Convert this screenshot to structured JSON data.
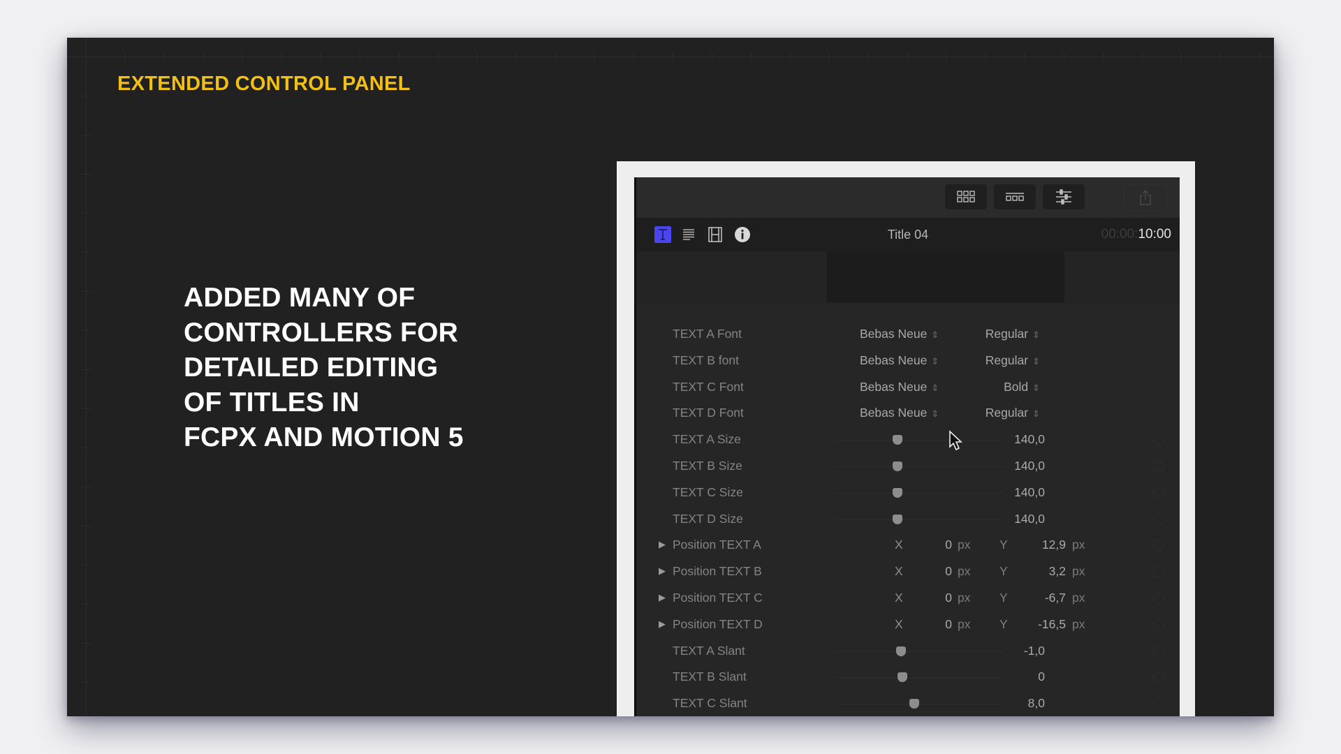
{
  "slide": {
    "heading": "EXTENDED CONTROL PANEL",
    "heading_color": "#f2c014",
    "body_lines": [
      "ADDED MANY OF",
      "CONTROLLERS FOR",
      "DETAILED EDITING",
      "OF TITLES IN",
      "FCPX AND MOTION 5"
    ]
  },
  "inspector": {
    "toolbar": {
      "buttons": [
        {
          "name": "browser-grid-icon"
        },
        {
          "name": "timeline-icon"
        },
        {
          "name": "inspector-sliders-icon"
        },
        {
          "name": "share-icon"
        }
      ]
    },
    "tabs": [
      {
        "name": "text-tab-icon",
        "active": true
      },
      {
        "name": "title-tab-icon",
        "active": false
      },
      {
        "name": "video-tab-icon",
        "active": false
      },
      {
        "name": "info-tab-icon",
        "active": false
      }
    ],
    "accent_color": "#4b45f0",
    "title": "Title 04",
    "timecode_dim": "00:00:",
    "timecode": "10:00",
    "fonts": [
      {
        "label": "TEXT A Font",
        "font": "Bebas Neue",
        "style": "Regular"
      },
      {
        "label": "TEXT B font",
        "font": "Bebas Neue",
        "style": "Regular"
      },
      {
        "label": "TEXT C Font",
        "font": "Bebas Neue",
        "style": "Bold"
      },
      {
        "label": "TEXT D Font",
        "font": "Bebas Neue",
        "style": "Regular"
      }
    ],
    "sizes": [
      {
        "label": "TEXT A Size",
        "value": "140,0",
        "slider_fraction": 0.37
      },
      {
        "label": "TEXT B Size",
        "value": "140,0",
        "slider_fraction": 0.37
      },
      {
        "label": "TEXT C Size",
        "value": "140,0",
        "slider_fraction": 0.37
      },
      {
        "label": "TEXT D Size",
        "value": "140,0",
        "slider_fraction": 0.37
      }
    ],
    "positions": [
      {
        "label": "Position TEXT A",
        "x_label": "X",
        "x": "0",
        "y_label": "Y",
        "y": "12,9",
        "unit": "px"
      },
      {
        "label": "Position TEXT B",
        "x_label": "X",
        "x": "0",
        "y_label": "Y",
        "y": "3,2",
        "unit": "px"
      },
      {
        "label": "Position TEXT C",
        "x_label": "X",
        "x": "0",
        "y_label": "Y",
        "y": "-6,7",
        "unit": "px"
      },
      {
        "label": "Position TEXT D",
        "x_label": "X",
        "x": "0",
        "y_label": "Y",
        "y": "-16,5",
        "unit": "px"
      }
    ],
    "slants": [
      {
        "label": "TEXT A Slant",
        "value": "-1,0",
        "slider_fraction": 0.39
      },
      {
        "label": "TEXT B Slant",
        "value": "0",
        "slider_fraction": 0.4
      },
      {
        "label": "TEXT C Slant",
        "value": "8,0",
        "slider_fraction": 0.47
      }
    ],
    "updown_glyph": "⇕",
    "disclosure_glyph": "▶"
  }
}
